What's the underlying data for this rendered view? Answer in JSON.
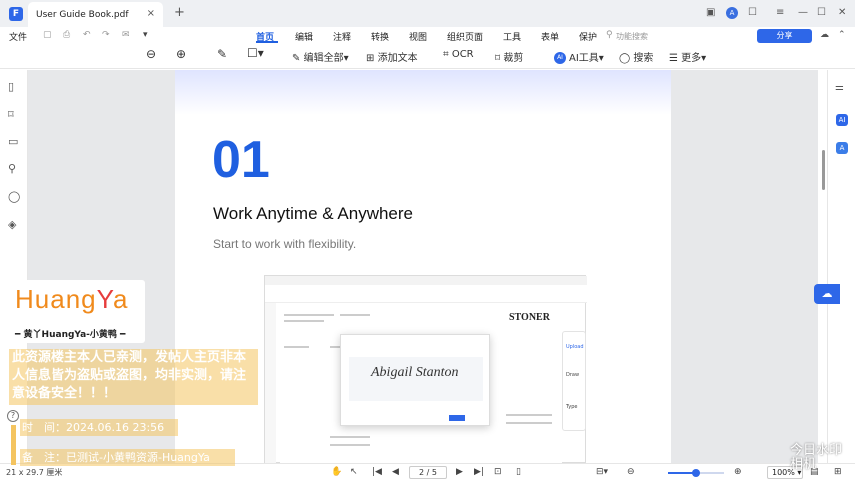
{
  "titlebar": {
    "app_logo": "F",
    "tab_title": "User Guide Book.pdf",
    "close": "×",
    "new_tab": "+",
    "avatar": "A",
    "icons": [
      "bell-icon",
      "user-icon",
      "menu-icon",
      "minimize-icon",
      "maximize-icon",
      "close-icon"
    ]
  },
  "menubar": {
    "file": "文件",
    "items": [
      "首页",
      "编辑",
      "注释",
      "转换",
      "视图",
      "组织页面",
      "工具",
      "表单",
      "保护"
    ],
    "active": "首页",
    "feature_search": "功能搜索",
    "share": "分享"
  },
  "toolbar": {
    "edit_all": "编辑全部",
    "add_text": "添加文本",
    "ocr": "OCR",
    "crop": "裁剪",
    "ai_badge": "AI",
    "ai_tools": "AI工具",
    "search": "搜索",
    "more": "更多"
  },
  "document": {
    "chapter_number": "01",
    "chapter_title": "Work Anytime & Anywhere",
    "chapter_subtitle": "Start to work with flexibility.",
    "embedded": {
      "brand": "STONER",
      "signature": "Abigail Stanton",
      "panel": [
        "Upload",
        "Draw",
        "Type"
      ]
    }
  },
  "statusbar": {
    "page_size": "21 x 29.7 厘米",
    "page_current": "2",
    "page_total": "5",
    "page_display": "2 / 5",
    "zoom": "100%",
    "zoom_fraction": 0.5
  },
  "watermark": {
    "logo_a": "Huang",
    "logo_b": "Y",
    "logo_c": "a",
    "sub": "━ 黄丫HuangYa-小黄鸭 ━",
    "notice": "此资源楼主本人已亲测，发帖人主页非本人信息皆为盗贴或盗图，均非实测，请注意设备安全！！！",
    "time": "时　间：2024.06.16 23:56",
    "remark": "备　注：已测试-小黄鸭资源-HuangYa",
    "corner": "今日水印 相机"
  },
  "colors": {
    "accent": "#2e67e8",
    "active_tab": "#1f5fe0",
    "watermark": "#f4c460"
  }
}
